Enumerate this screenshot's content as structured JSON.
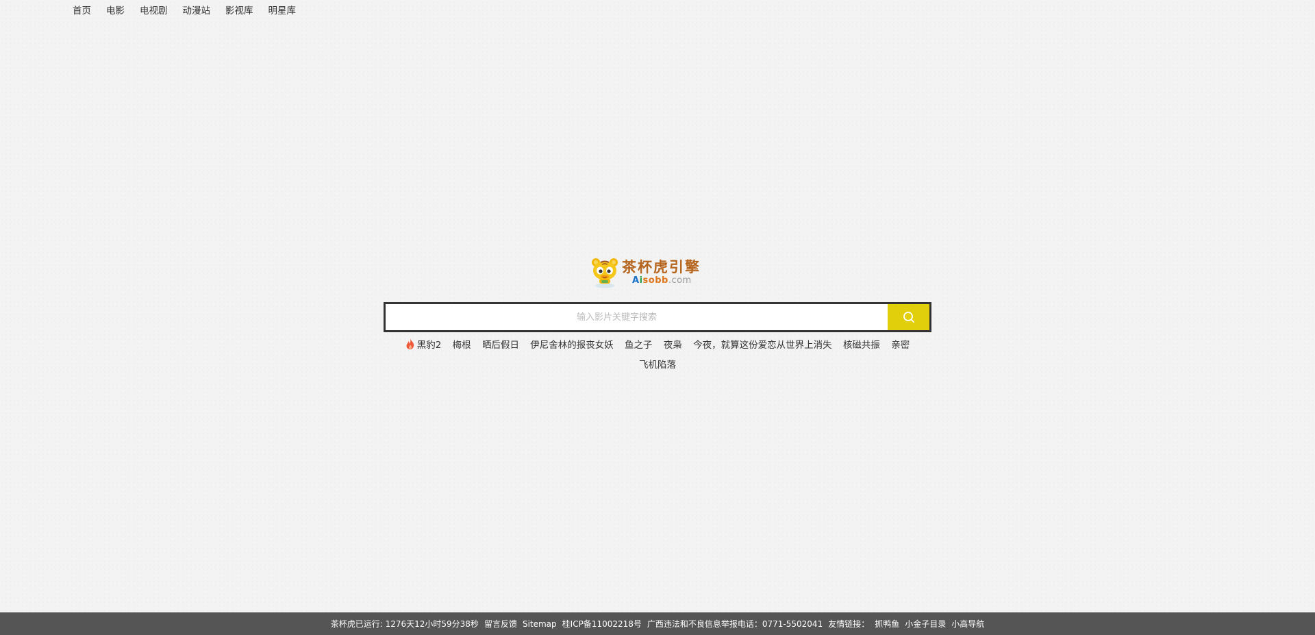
{
  "nav": {
    "items": [
      {
        "label": "首页"
      },
      {
        "label": "电影"
      },
      {
        "label": "电视剧"
      },
      {
        "label": "动漫站"
      },
      {
        "label": "影视库"
      },
      {
        "label": "明星库"
      }
    ]
  },
  "logo": {
    "title": "茶杯虎引擎",
    "domain_a": "A",
    "domain_i": "i",
    "domain_sobb": "sobb",
    "domain_com": ".com",
    "mascot_icon": "tiger-mascot-icon"
  },
  "search": {
    "placeholder": "输入影片关键字搜索",
    "value": "",
    "button_icon": "search-icon",
    "button_color": "#e2cf0c"
  },
  "hot": {
    "icon": "fire-icon",
    "icon_color": "#f0573a",
    "keywords": [
      "黑豹2",
      "梅根",
      "晒后假日",
      "伊尼舍林的报丧女妖",
      "鱼之子",
      "夜枭",
      "今夜，就算这份爱恋从世界上消失",
      "核磁共振",
      "亲密",
      "飞机陷落"
    ]
  },
  "footer": {
    "runtime": "茶杯虎已运行: 1276天12小时59分38秒",
    "feedback": "留言反馈",
    "sitemap": "Sitemap",
    "icp": "桂ICP备11002218号",
    "report": "广西违法和不良信息举报电话：0771-5502041",
    "links_label": "友情链接：",
    "links": [
      "抓鸭鱼",
      "小金子目录",
      "小高导航"
    ],
    "background": "#555555"
  }
}
